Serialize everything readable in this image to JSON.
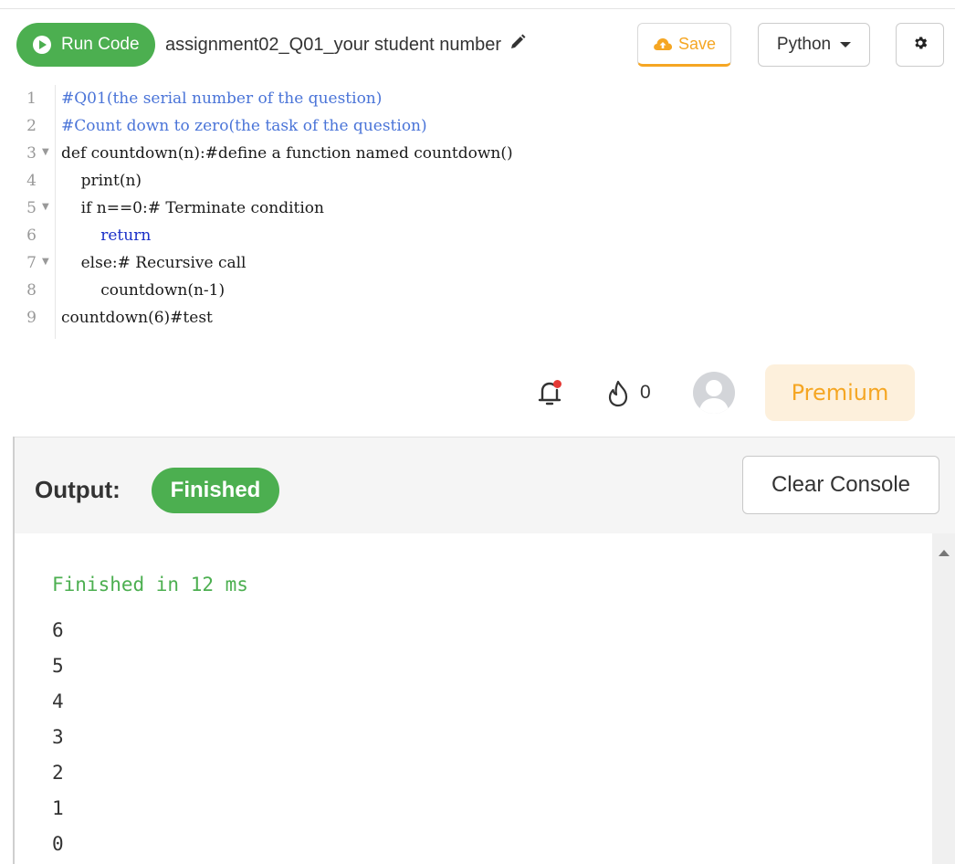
{
  "toolbar": {
    "run_label": "Run Code",
    "file_name": "assignment02_Q01_your student number",
    "save_label": "Save",
    "language": "Python"
  },
  "editor": {
    "lines": [
      {
        "no": "1",
        "code": "#Q01(the serial number of the question)"
      },
      {
        "no": "2",
        "code": "#Count down to zero(the task of the question)"
      },
      {
        "no": "3",
        "code": "def countdown(n):#define a function named countdown()"
      },
      {
        "no": "4",
        "code": "    print(n)"
      },
      {
        "no": "5",
        "code": "    if n==0:# Terminate condition"
      },
      {
        "no": "6",
        "code": "        return"
      },
      {
        "no": "7",
        "code": "    else:# Recursive call"
      },
      {
        "no": "8",
        "code": "        countdown(n-1)"
      },
      {
        "no": "9",
        "code": "countdown(6)#test"
      }
    ]
  },
  "header": {
    "streak_count": "0",
    "premium_label": "Premium"
  },
  "output": {
    "label": "Output:",
    "status": "Finished",
    "clear_label": "Clear Console",
    "finished_message": "Finished in 12 ms",
    "lines": [
      "6",
      "5",
      "4",
      "3",
      "2",
      "1",
      "0"
    ]
  },
  "colors": {
    "accent_green": "#4caf50",
    "save_orange": "#f5a623",
    "premium_bg": "#fdf0dc"
  },
  "icons": [
    "play-icon",
    "pencil-icon",
    "cloud-upload-icon",
    "caret-down-icon",
    "gear-icon",
    "bell-icon",
    "flame-icon",
    "avatar-icon"
  ]
}
